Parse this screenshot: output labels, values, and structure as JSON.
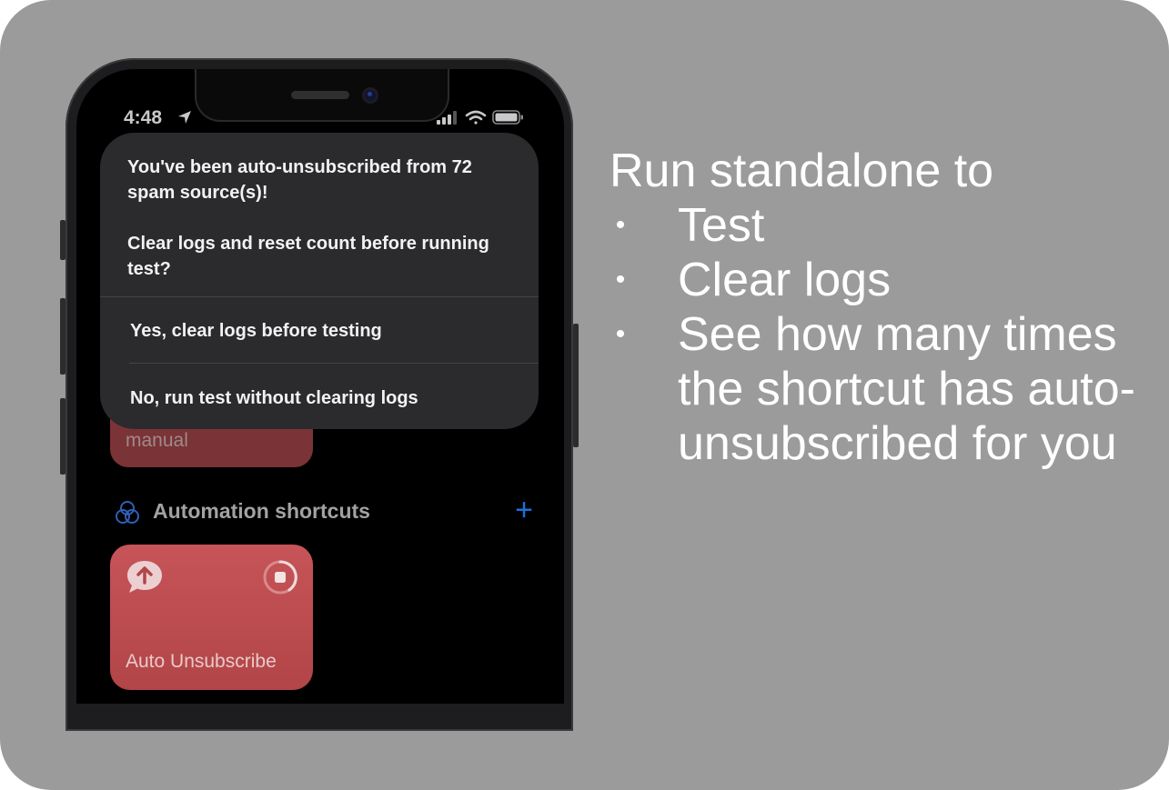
{
  "status": {
    "time": "4:48"
  },
  "alert": {
    "message_lines": [
      "You've been auto-unsubscribed from 72 spam source(s)!",
      "Clear logs and reset count before running test?"
    ],
    "options": [
      "Yes, clear logs before testing",
      "No, run test without clearing logs"
    ]
  },
  "background": {
    "top_card_label": "manual",
    "section_title": "Automation shortcuts",
    "add_button": "+",
    "shortcut_card_label": "Auto Unsubscribe"
  },
  "caption": {
    "heading": "Run standalone to",
    "bullets": [
      "Test",
      "Clear logs",
      "See how many times the shortcut has auto-unsubscribed for you"
    ]
  },
  "colors": {
    "slide_bg": "#9b9b9b",
    "card_red": "#c65458",
    "accent_blue": "#1e6fd9"
  }
}
